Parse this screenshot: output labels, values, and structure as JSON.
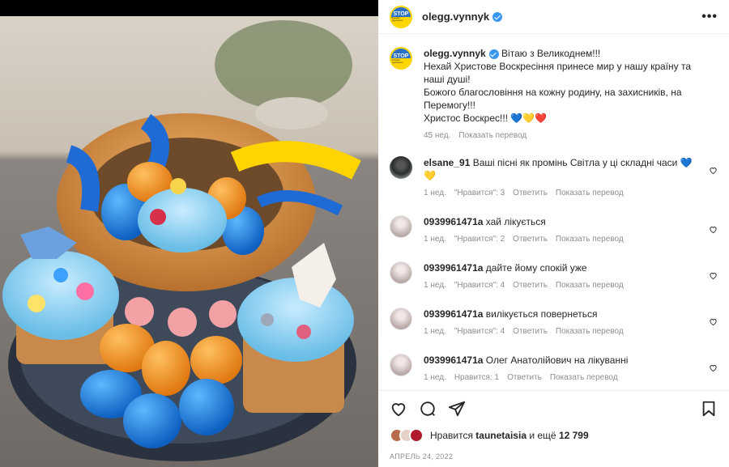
{
  "post": {
    "username": "olegg.vynnyk",
    "avatar_text_top": "STOP",
    "avatar_text_bottom": "Russian aggression",
    "more_label": "•••"
  },
  "caption": {
    "username": "olegg.vynnyk",
    "lines": [
      "Вітаю з Великоднем!!!",
      "Нехай Христове Воскресіння принесе мир у нашу країну та наші душі!",
      "Божого благословіння на кожну родину, на захисників, на Перемогу!!!",
      "Христос Воскрес!!! 💙💛❤️"
    ],
    "time": "45 нед.",
    "translate": "Показать перевод"
  },
  "comments": [
    {
      "username": "elsane_91",
      "text": "Ваші пісні як промінь Світла у ці складні часи 💙💛",
      "time": "1 нед.",
      "likes": "\"Нравится\": 3",
      "reply": "Ответить",
      "translate": "Показать перевод"
    },
    {
      "username": "0939961471a",
      "text": "хай лікується",
      "time": "1 нед.",
      "likes": "\"Нравится\": 2",
      "reply": "Ответить",
      "translate": "Показать перевод"
    },
    {
      "username": "0939961471a",
      "text": "дайте йому спокій уже",
      "time": "1 нед.",
      "likes": "\"Нравится\": 4",
      "reply": "Ответить",
      "translate": "Показать перевод"
    },
    {
      "username": "0939961471a",
      "text": "вилікується повернеться",
      "time": "1 нед.",
      "likes": "\"Нравится\": 4",
      "reply": "Ответить",
      "translate": "Показать перевод"
    },
    {
      "username": "0939961471a",
      "text": "Олег Анатолійович на лікуванні",
      "time": "1 нед.",
      "likes": "Нравится: 1",
      "reply": "Ответить",
      "translate": "Показать перевод"
    }
  ],
  "likes": {
    "prefix": "Нравится",
    "user": "taunetaisia",
    "middle": "и ещё",
    "count": "12 799"
  },
  "date": "АПРЕЛЬ 24, 2022",
  "colors": {
    "accent": "#3897f0",
    "text": "#262626",
    "muted": "#8e8e8e"
  }
}
